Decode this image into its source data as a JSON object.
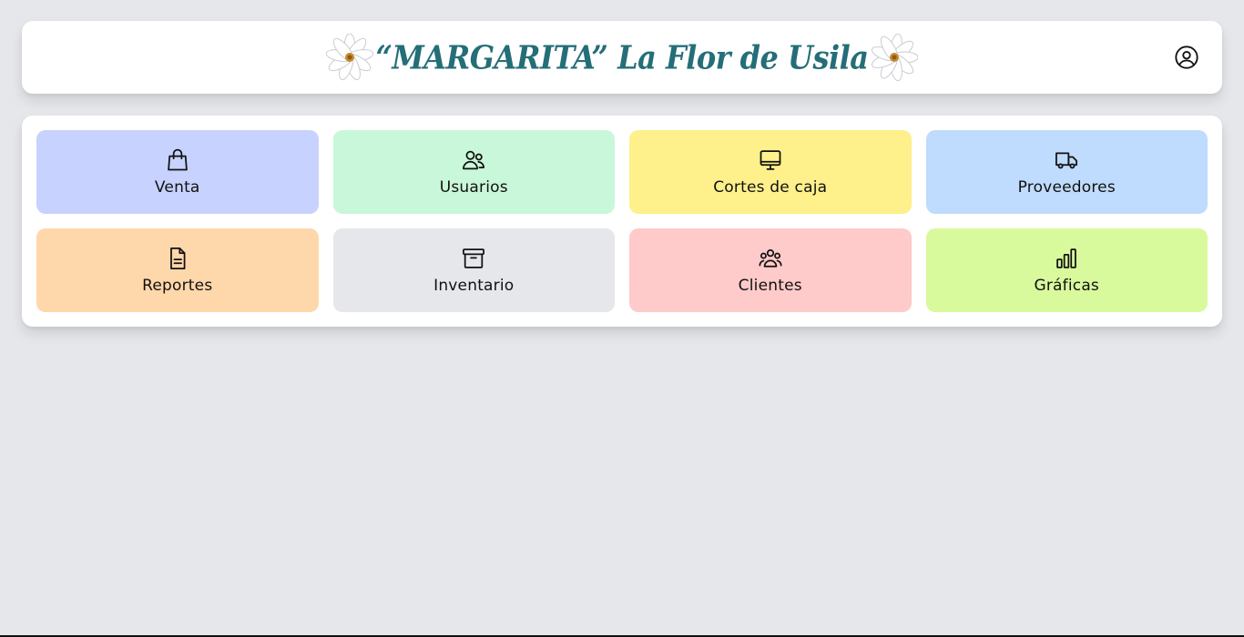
{
  "header": {
    "title": "“MARGARITA” La Flor de Usila",
    "left_logo_icon": "daisy-flower-icon",
    "right_logo_icon": "daisy-flower-icon",
    "user_icon": "user-circle-icon",
    "title_color": "#246e78"
  },
  "menu": {
    "tiles": [
      {
        "label": "Venta",
        "icon": "shopping-bag-icon",
        "color": "#c7d2fe"
      },
      {
        "label": "Usuarios",
        "icon": "users-icon",
        "color": "#c9f7d9"
      },
      {
        "label": "Cortes de caja",
        "icon": "monitor-icon",
        "color": "#fef08a"
      },
      {
        "label": "Proveedores",
        "icon": "truck-icon",
        "color": "#bfdbfe"
      },
      {
        "label": "Reportes",
        "icon": "document-icon",
        "color": "#fed7aa"
      },
      {
        "label": "Inventario",
        "icon": "archive-box-icon",
        "color": "#e5e7eb"
      },
      {
        "label": "Clientes",
        "icon": "user-group-icon",
        "color": "#fecaca"
      },
      {
        "label": "Gráficas",
        "icon": "bar-chart-icon",
        "color": "#d9f99d"
      }
    ]
  }
}
